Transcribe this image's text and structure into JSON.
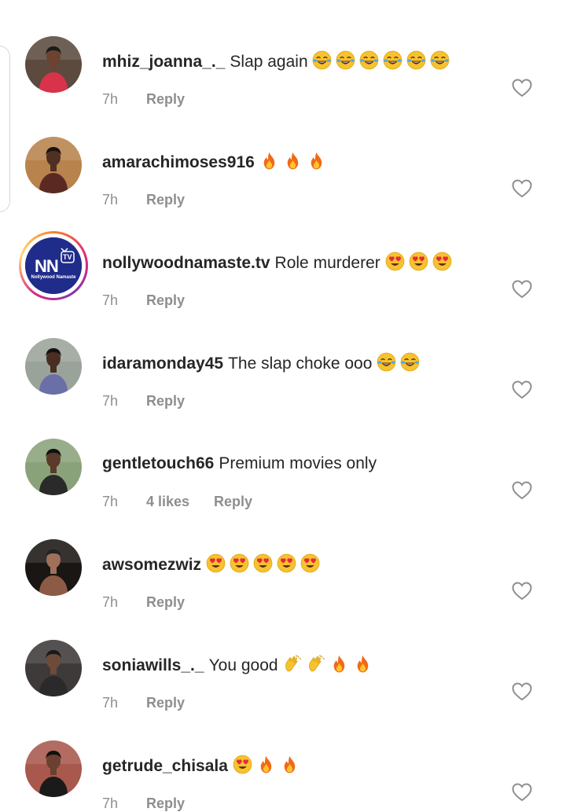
{
  "comments": [
    {
      "username": "mhiz_joanna_._",
      "text": "Slap again",
      "emojis": [
        "joy-emoji",
        "joy-emoji",
        "joy-emoji",
        "joy-emoji",
        "joy-emoji",
        "joy-emoji"
      ],
      "time": "7h",
      "likes": "",
      "reply_label": "Reply",
      "avatar_icon": "user-photo-avatar"
    },
    {
      "username": "amarachimoses916",
      "text": "",
      "emojis": [
        "fire-emoji",
        "fire-emoji",
        "fire-emoji"
      ],
      "time": "7h",
      "likes": "",
      "reply_label": "Reply",
      "avatar_icon": "user-photo-avatar"
    },
    {
      "username": "nollywoodnamaste.tv",
      "text": "Role murderer",
      "emojis": [
        "heart-eyes-emoji",
        "heart-eyes-emoji",
        "heart-eyes-emoji"
      ],
      "time": "7h",
      "likes": "",
      "reply_label": "Reply",
      "avatar_icon": "brand-logo-avatar",
      "avatar_logo_text": "NN",
      "avatar_logo_sup": "TV",
      "avatar_logo_sub": "Nollywood Namaste"
    },
    {
      "username": "idaramonday45",
      "text": "The slap choke ooo",
      "emojis": [
        "joy-emoji",
        "joy-emoji"
      ],
      "time": "7h",
      "likes": "",
      "reply_label": "Reply",
      "avatar_icon": "user-photo-avatar"
    },
    {
      "username": "gentletouch66",
      "text": "Premium movies only",
      "emojis": [],
      "time": "7h",
      "likes": "4 likes",
      "reply_label": "Reply",
      "avatar_icon": "user-photo-avatar"
    },
    {
      "username": "awsomezwiz",
      "text": "",
      "emojis": [
        "heart-eyes-emoji",
        "heart-eyes-emoji",
        "heart-eyes-emoji",
        "heart-eyes-emoji",
        "heart-eyes-emoji"
      ],
      "time": "7h",
      "likes": "",
      "reply_label": "Reply",
      "avatar_icon": "user-photo-avatar"
    },
    {
      "username": "soniawills_._",
      "text": "You good",
      "emojis": [
        "clap-emoji",
        "clap-emoji",
        "fire-emoji",
        "fire-emoji"
      ],
      "time": "7h",
      "likes": "",
      "reply_label": "Reply",
      "avatar_icon": "user-photo-avatar"
    },
    {
      "username": "getrude_chisala",
      "text": "",
      "emojis": [
        "heart-eyes-emoji",
        "fire-emoji",
        "fire-emoji"
      ],
      "time": "7h",
      "likes": "",
      "reply_label": "Reply",
      "avatar_icon": "user-photo-avatar"
    }
  ],
  "colors": {
    "username": "#262626",
    "meta_text": "#8e8e8e",
    "heart_outline": "#8e8e8e",
    "emoji_yellow": "#f7c22f",
    "fire_orange": "#f06a16",
    "brand_avatar_bg": "#1f2c8a"
  },
  "icons": {
    "like_button": "heart-outline-icon"
  }
}
